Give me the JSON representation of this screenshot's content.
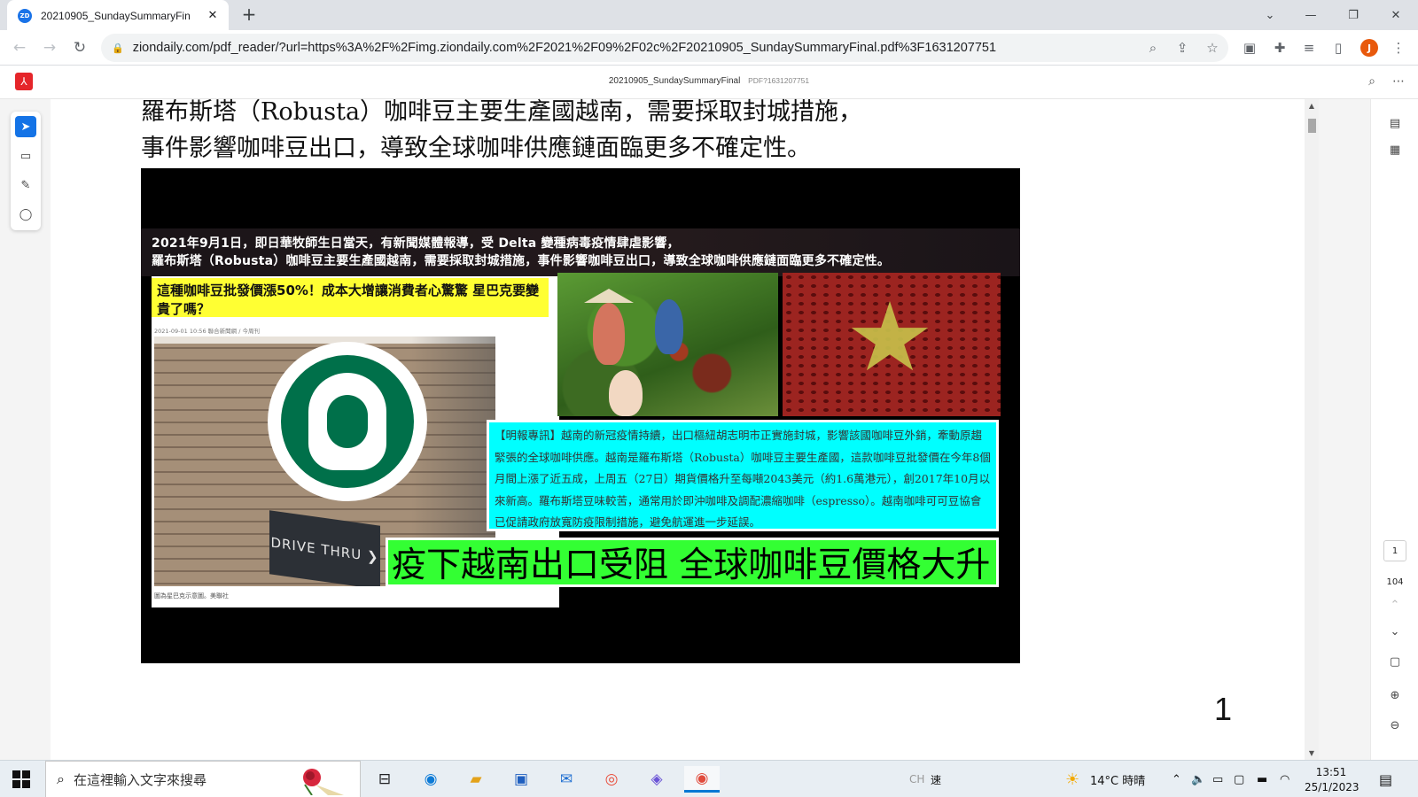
{
  "browser": {
    "tab_title": "20210905_SundaySummaryFin",
    "tab_favicon": "ZD",
    "tab_close": "✕",
    "new_tab": "+",
    "url": "ziondaily.com/pdf_reader/?url=https%3A%2F%2Fimg.ziondaily.com%2F2021%2F09%2F02c%2F20210905_SundaySummaryFinal.pdf%3F1631207751",
    "profile_initial": "J"
  },
  "pdf_viewer": {
    "doc_title": "20210905_SundaySummaryFinal",
    "doc_subtitle": "PDF?1631207751",
    "current_page": "1",
    "total_pages": "104"
  },
  "page": {
    "heading_line1": "羅布斯塔（Robusta）咖啡豆主要生產國越南，需要採取封城措施，",
    "heading_line2": "事件影響咖啡豆出口，導致全球咖啡供應鏈面臨更多不確定性。",
    "page_number": "1",
    "figure": {
      "caption_line1": "2021年9月1日，即日華牧師生日當天，有新聞媒體報導，受 Delta 變種病毒疫情肆虐影響，",
      "caption_line2": "羅布斯塔（Robusta）咖啡豆主要生產國越南，需要採取封城措施，事件影響咖啡豆出口，導致全球咖啡供應鏈面臨更多不確定性。",
      "news_headline": "這種咖啡豆批發價漲50%！成本大增讓消費者心驚驚 星巴克要變貴了嗎？",
      "news_meta": "2021-09-01 10:56 聯合新聞網 / 今周刊",
      "starbucks_sign": "DRIVE THRU ❯",
      "news_credit": "圖為星巴克示意圖。美聯社",
      "mingpao_text": "【明報專訊】越南的新冠疫情持續，出口樞紐胡志明市正實施封城，影響該國咖啡豆外銷，牽動原趨緊張的全球咖啡供應。越南是羅布斯塔（Robusta）咖啡豆主要生產國，這款咖啡豆批發價在今年8個月間上漲了近五成，上周五（27日）期貨價格升至每噸2043美元（約1.6萬港元），創2017年10月以來新高。羅布斯塔豆味較苦，通常用於即沖咖啡及調配濃縮咖啡（espresso）。越南咖啡可可豆協會已促請政府放寬防疫限制措施，避免航運進一步延誤。",
      "green_headline": "疫下越南出口受阻 全球咖啡豆價格大升"
    }
  },
  "taskbar": {
    "search_placeholder": "在這裡輸入文字來搜尋",
    "ime_lang": "CH",
    "ime_mode": "速",
    "weather": "14°C  時晴",
    "time": "13:51",
    "date": "25/1/2023"
  },
  "icons": {
    "back": "back-arrow-icon",
    "forward": "forward-arrow-icon",
    "reload": "reload-icon",
    "lock": "lock-icon",
    "zoom": "zoom-icon",
    "share": "share-icon",
    "bookmark": "star-icon",
    "extensions": "puzzle-icon",
    "media": "media-icon",
    "sidepanel": "side-panel-icon",
    "menu": "kebab-menu-icon"
  }
}
